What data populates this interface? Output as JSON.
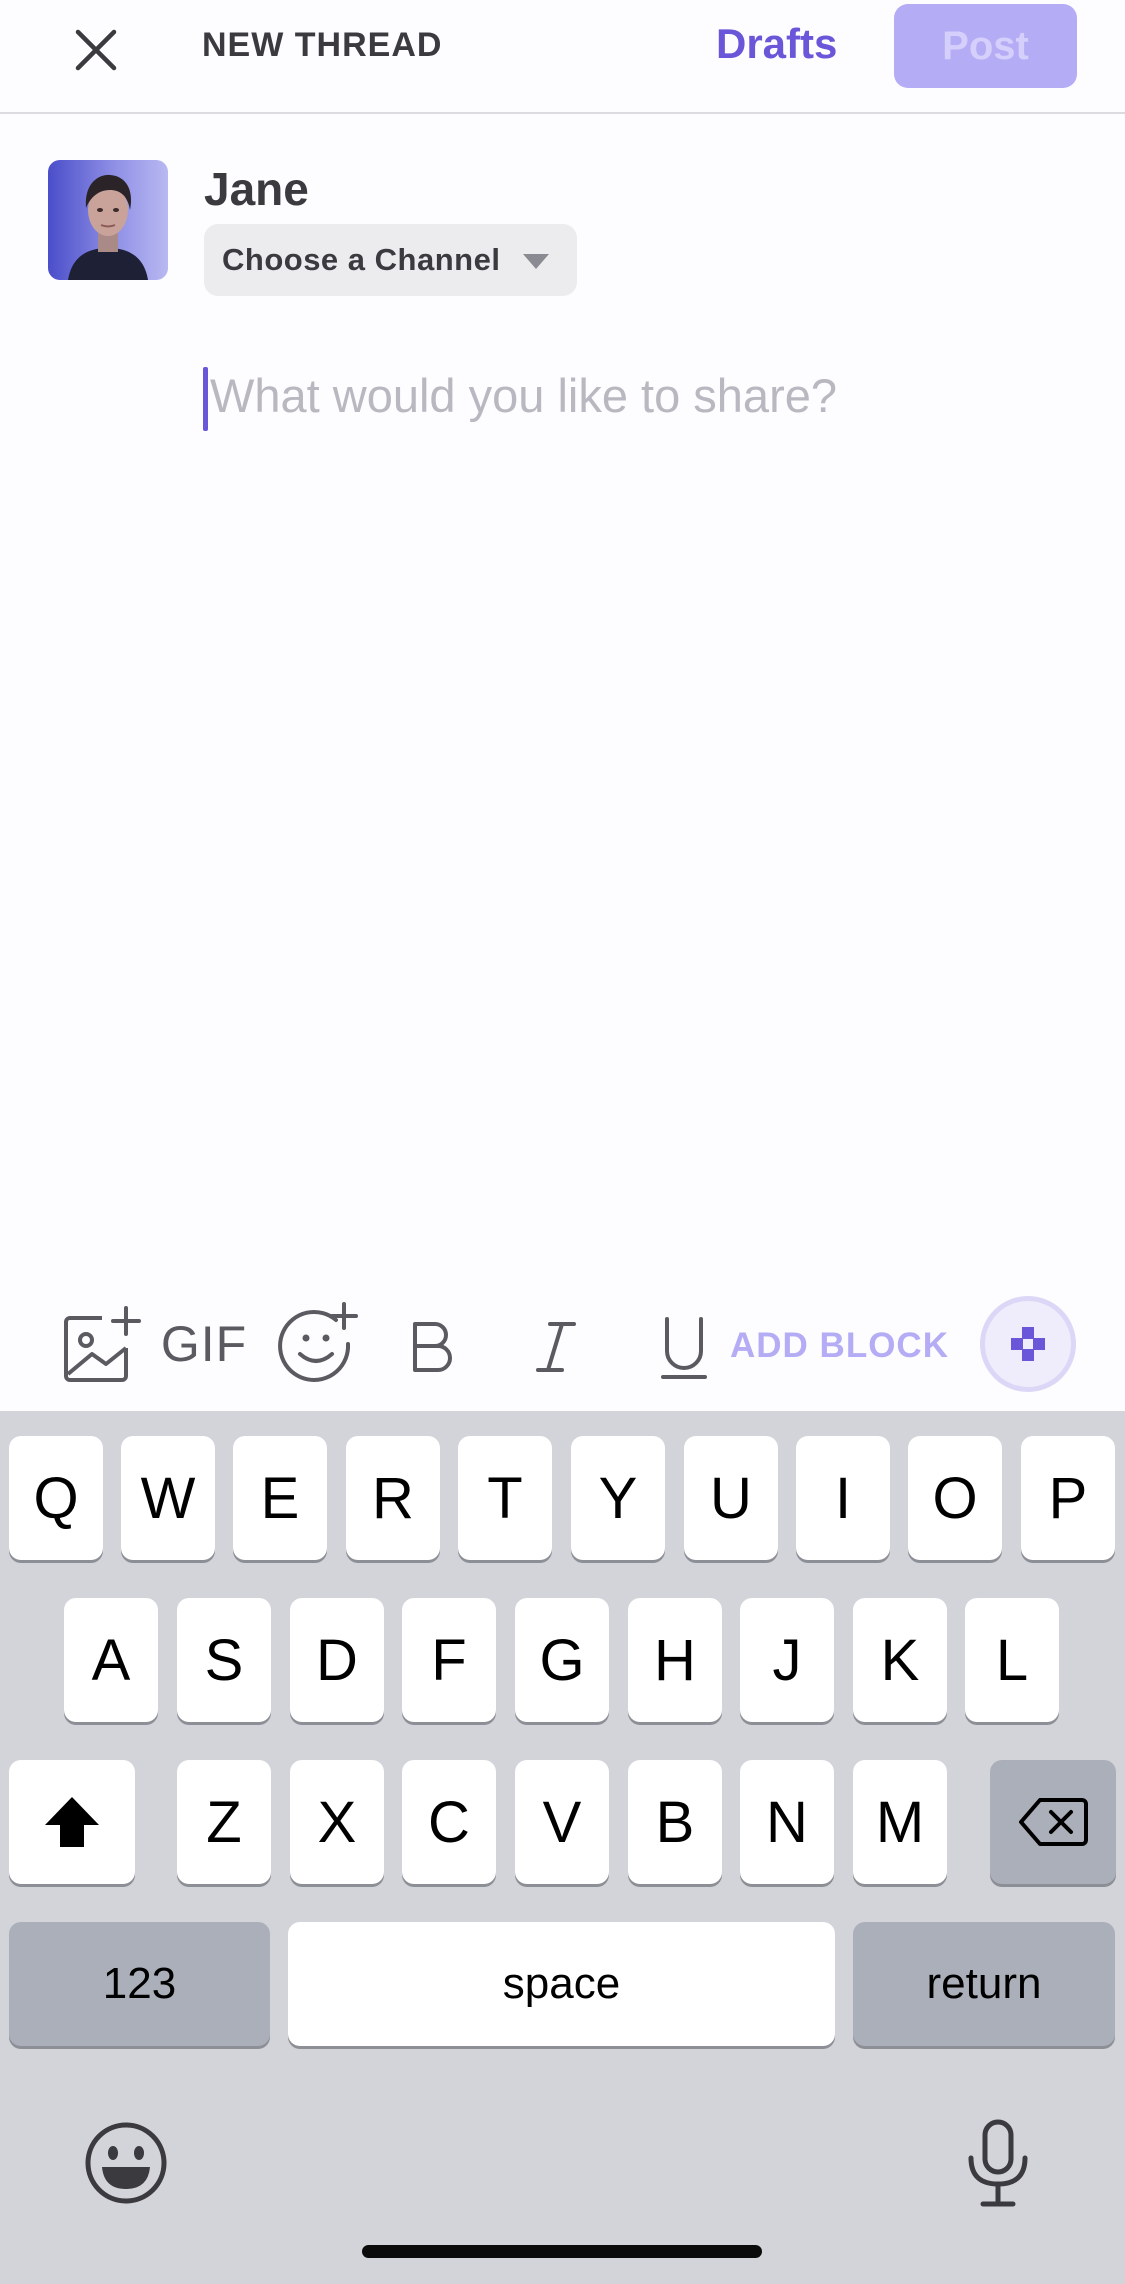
{
  "header": {
    "close_icon": "close-icon",
    "title": "NEW THREAD",
    "drafts_label": "Drafts",
    "post_label": "Post"
  },
  "composer": {
    "username": "Jane",
    "channel_placeholder": "Choose a Channel",
    "body_placeholder": "What would you like to share?",
    "body_value": ""
  },
  "toolbar": {
    "image_icon": "add-image-icon",
    "gif_label": "GIF",
    "emoji_icon": "add-emoji-icon",
    "bold_label": "B",
    "italic_label": "I",
    "underline_label": "U",
    "add_block_label": "ADD BLOCK",
    "fab_icon": "blocks-icon"
  },
  "keyboard": {
    "row1": [
      "Q",
      "W",
      "E",
      "R",
      "T",
      "Y",
      "U",
      "I",
      "O",
      "P"
    ],
    "row2": [
      "A",
      "S",
      "D",
      "F",
      "G",
      "H",
      "J",
      "K",
      "L"
    ],
    "row3": [
      "Z",
      "X",
      "C",
      "V",
      "B",
      "N",
      "M"
    ],
    "numbers_label": "123",
    "space_label": "space",
    "return_label": "return"
  },
  "colors": {
    "accent": "#6a56d8",
    "accent_light": "#b4acf5",
    "keyboard_bg": "#d3d4da"
  }
}
